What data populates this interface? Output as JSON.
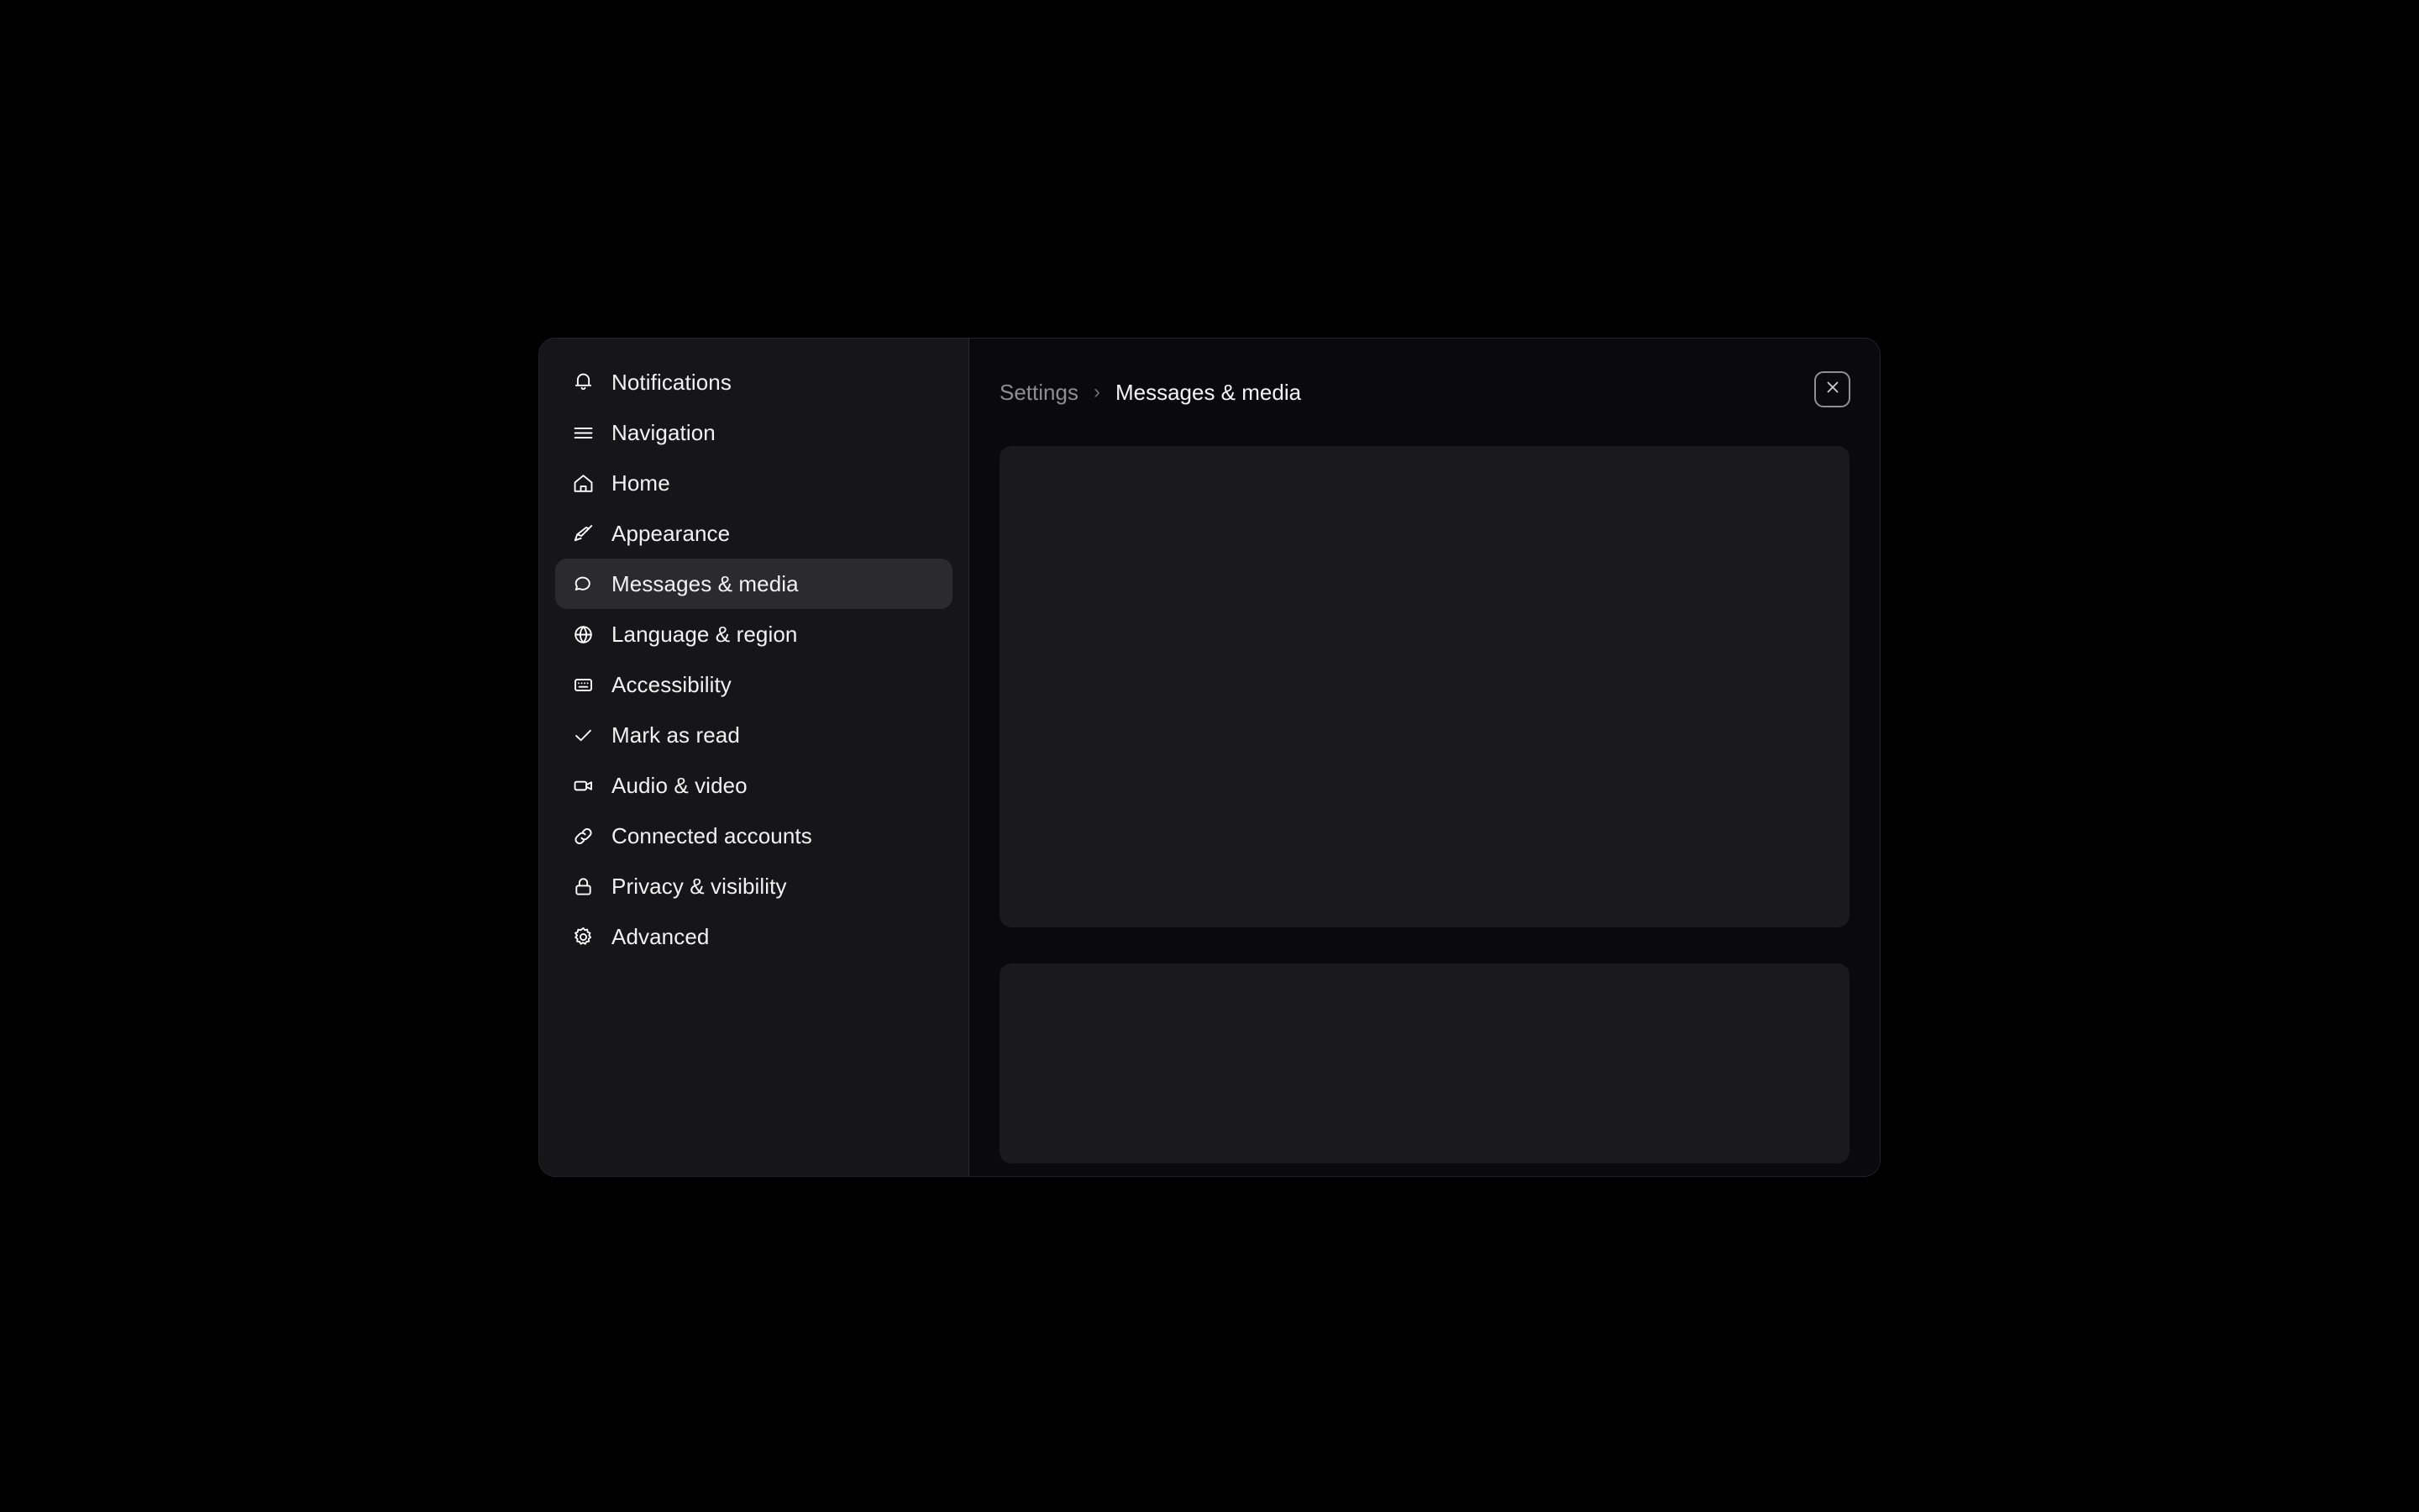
{
  "dialog": {
    "name": "settings-dialog"
  },
  "sidebar": {
    "items": [
      {
        "label": "Notifications",
        "icon": "bell-icon",
        "selected": false
      },
      {
        "label": "Navigation",
        "icon": "menu-icon",
        "selected": false
      },
      {
        "label": "Home",
        "icon": "home-icon",
        "selected": false
      },
      {
        "label": "Appearance",
        "icon": "paintbrush-icon",
        "selected": false
      },
      {
        "label": "Messages & media",
        "icon": "chat-bubble-icon",
        "selected": true
      },
      {
        "label": "Language & region",
        "icon": "globe-icon",
        "selected": false
      },
      {
        "label": "Accessibility",
        "icon": "keyboard-icon",
        "selected": false
      },
      {
        "label": "Mark as read",
        "icon": "check-icon",
        "selected": false
      },
      {
        "label": "Audio & video",
        "icon": "video-camera-icon",
        "selected": false
      },
      {
        "label": "Connected accounts",
        "icon": "link-icon",
        "selected": false
      },
      {
        "label": "Privacy & visibility",
        "icon": "lock-icon",
        "selected": false
      },
      {
        "label": "Advanced",
        "icon": "gear-icon",
        "selected": false
      }
    ]
  },
  "header": {
    "breadcrumb": {
      "root": "Settings",
      "separator": "›",
      "current": "Messages & media"
    },
    "close_icon": "close-icon"
  },
  "content": {
    "panels": [
      {
        "name": "content-panel-primary",
        "size": "tall"
      },
      {
        "name": "content-panel-secondary",
        "size": "short"
      }
    ]
  },
  "colors": {
    "backdrop": "#000000",
    "dialog_bg": "#0a0a0c",
    "sidebar_bg": "#161618",
    "selected_bg": "#2b2b2f",
    "card_bg": "#1a1a1d",
    "text_primary": "#f2f2f3",
    "text_muted": "#8d8d93",
    "divider": "#2a2a2e"
  }
}
